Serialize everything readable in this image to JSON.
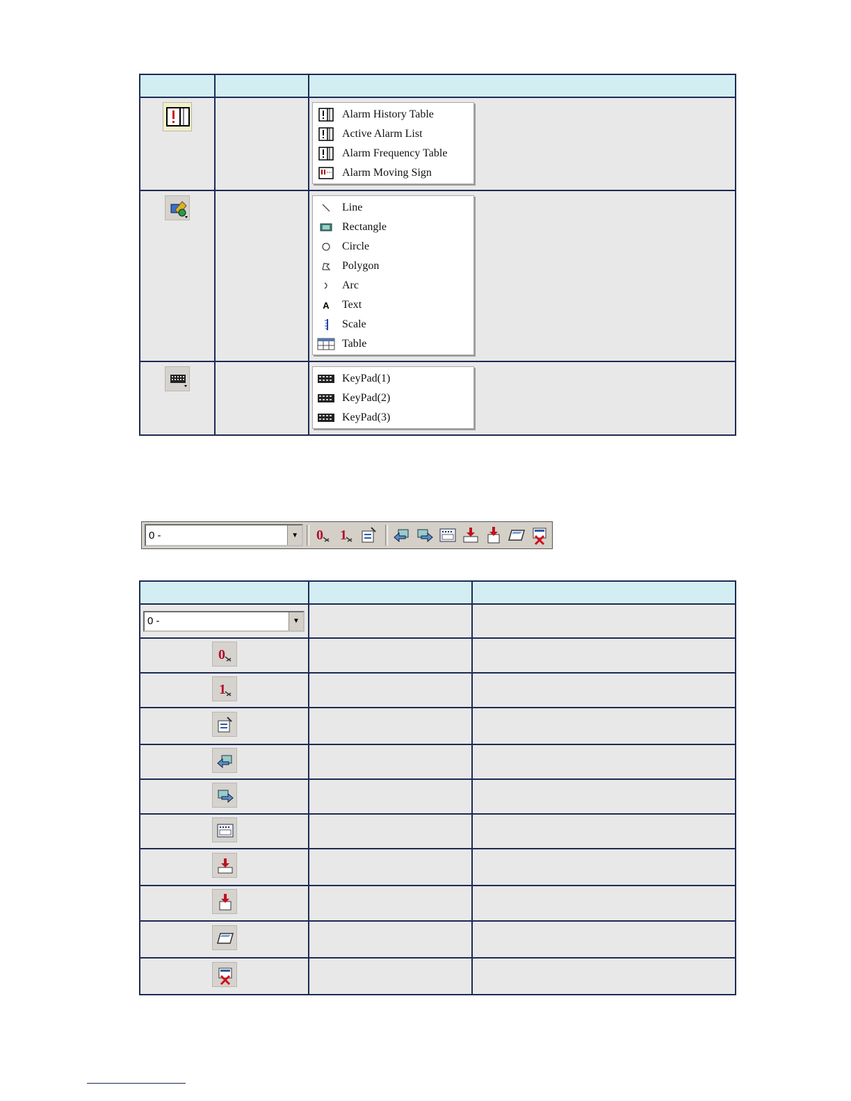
{
  "table1": {
    "rows": [
      {
        "icon": "alarm-icon",
        "menu": [
          {
            "icon": "alarm-table-icon",
            "label": "Alarm History Table"
          },
          {
            "icon": "alarm-table-icon",
            "label": "Active Alarm List"
          },
          {
            "icon": "alarm-table-icon",
            "label": "Alarm Frequency Table"
          },
          {
            "icon": "moving-sign-icon",
            "label": "Alarm Moving Sign"
          }
        ]
      },
      {
        "icon": "drawing-tools-icon",
        "menu": [
          {
            "icon": "line-icon",
            "label": "Line"
          },
          {
            "icon": "rectangle-icon",
            "label": "Rectangle"
          },
          {
            "icon": "circle-icon",
            "label": "Circle"
          },
          {
            "icon": "polygon-icon",
            "label": "Polygon"
          },
          {
            "icon": "arc-icon",
            "label": "Arc"
          },
          {
            "icon": "text-icon",
            "label": "Text"
          },
          {
            "icon": "scale-icon",
            "label": "Scale"
          },
          {
            "icon": "table-icon",
            "label": "Table"
          }
        ]
      },
      {
        "icon": "keypad-icon",
        "menu": [
          {
            "icon": "keypad-icon",
            "label": "KeyPad(1)"
          },
          {
            "icon": "keypad-icon",
            "label": "KeyPad(2)"
          },
          {
            "icon": "keypad-icon",
            "label": "KeyPad(3)"
          }
        ]
      }
    ]
  },
  "toolbar": {
    "combo_value": "0 -",
    "buttons": [
      "state-0-icon",
      "state-1-icon",
      "properties-icon",
      "back-icon",
      "forward-icon",
      "screen-icon",
      "download-icon",
      "upload-icon",
      "frame-icon",
      "delete-icon"
    ]
  },
  "table2": {
    "combo_value": "0 -",
    "rows": [
      "state-0-icon",
      "state-1-icon",
      "properties-icon",
      "back-icon",
      "forward-icon",
      "screen-icon",
      "download-icon",
      "upload-icon",
      "frame-icon",
      "delete-icon"
    ]
  }
}
